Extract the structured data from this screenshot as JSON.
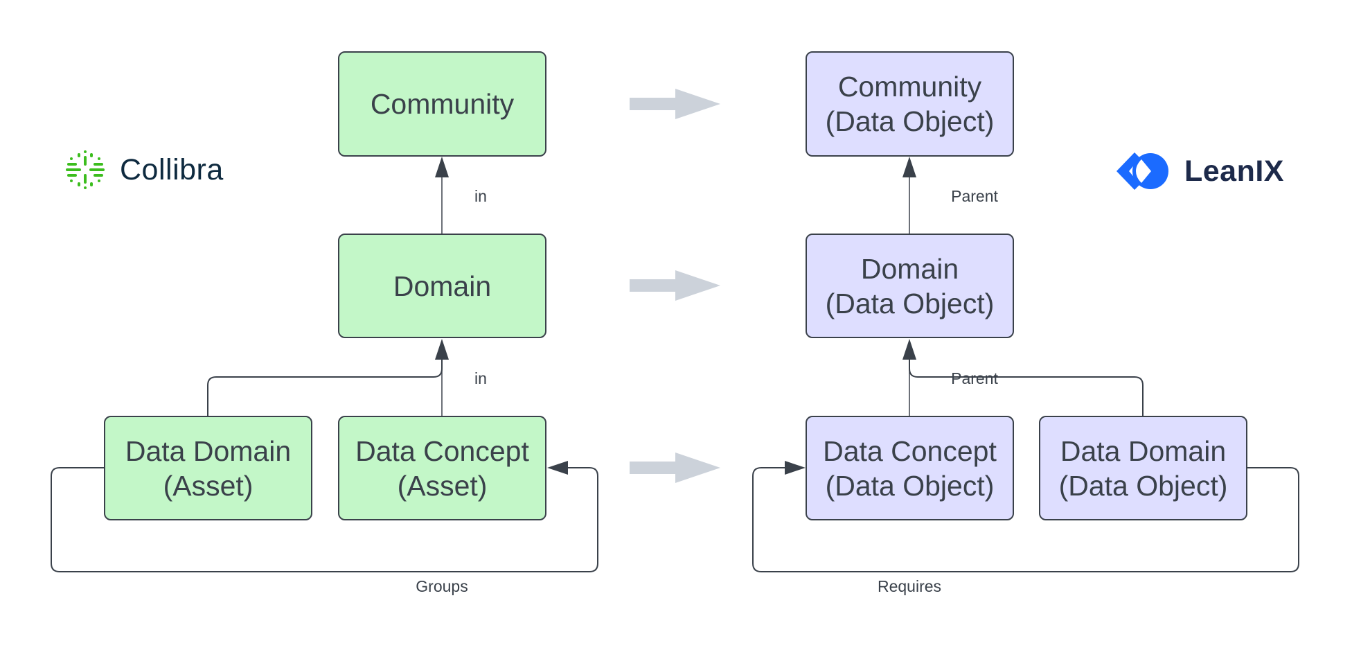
{
  "logos": {
    "left": {
      "name": "Collibra",
      "icon": "collibra-icon",
      "color": "#3cbd1e"
    },
    "right": {
      "name": "LeanIX",
      "icon": "leanix-icon",
      "color": "#1b6bff"
    }
  },
  "collibra_nodes": {
    "community": {
      "line1": "Community",
      "line2": ""
    },
    "domain": {
      "line1": "Domain",
      "line2": ""
    },
    "data_domain": {
      "line1": "Data Domain",
      "line2": "(Asset)"
    },
    "data_concept": {
      "line1": "Data Concept",
      "line2": "(Asset)"
    }
  },
  "leanix_nodes": {
    "community": {
      "line1": "Community",
      "line2": "(Data Object)"
    },
    "domain": {
      "line1": "Domain",
      "line2": "(Data Object)"
    },
    "data_concept": {
      "line1": "Data Concept",
      "line2": "(Data Object)"
    },
    "data_domain": {
      "line1": "Data Domain",
      "line2": "(Data Object)"
    }
  },
  "edge_labels": {
    "collibra_in_top": "in",
    "collibra_in_bottom": "in",
    "collibra_groups": "Groups",
    "leanix_parent_top": "Parent",
    "leanix_parent_bottom": "Parent",
    "leanix_requires": "Requires"
  },
  "colors": {
    "collibra_fill": "#c3f7c8",
    "leanix_fill": "#dedeff",
    "stroke": "#3a414a",
    "mapping_arrow": "#ccd2da"
  }
}
